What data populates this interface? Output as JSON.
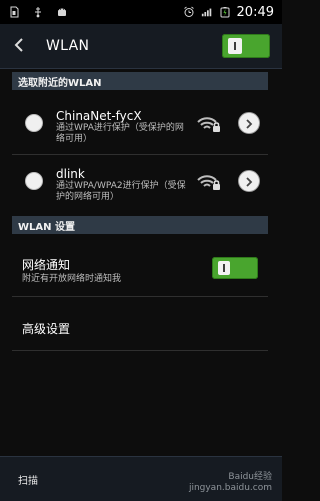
{
  "status_bar": {
    "time": "20:49",
    "icons": [
      "sim-icon",
      "usb-icon",
      "android-icon",
      "alarm-icon",
      "signal-icon",
      "battery-charging-icon"
    ]
  },
  "app_bar": {
    "title": "WLAN",
    "back_icon": "back-icon",
    "wifi_enabled": true
  },
  "sections": {
    "nearby_header": "选取附近的WLAN",
    "wlan_settings_header": "WLAN 设置"
  },
  "networks": [
    {
      "name": "ChinaNet-fycX",
      "desc": "通过WPA进行保护（受保护的网络可用）",
      "selected": false,
      "signal_icon": "wifi-lock-icon"
    },
    {
      "name": "dlink",
      "desc": "通过WPA/WPA2进行保护（受保护的网络可用）",
      "selected": false,
      "signal_icon": "wifi-lock-icon"
    }
  ],
  "settings": {
    "network_notify": {
      "title": "网络通知",
      "subtitle": "附近有开放网络时通知我",
      "enabled": true
    },
    "advanced": {
      "title": "高级设置"
    }
  },
  "bottom_bar": {
    "scan_label": "扫描"
  },
  "watermark": {
    "line1": "Baidu经验",
    "line2": "jingyan.baidu.com"
  },
  "colors": {
    "accent_green": "#49a52e",
    "header_bg": "#2f3a46",
    "bar_bg": "#161b22"
  }
}
